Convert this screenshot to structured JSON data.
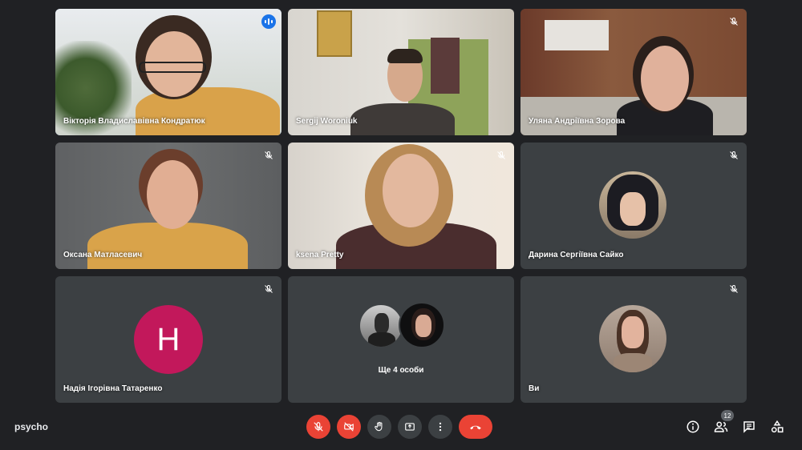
{
  "meeting": {
    "name": "psycho"
  },
  "participants": [
    {
      "name": "Вікторія Владиславівна Кондратюк",
      "speaking": true
    },
    {
      "name": "Sergij Woroniuk"
    },
    {
      "name": "Уляна Андріївна Зорова"
    },
    {
      "name": "Оксана Матласевич"
    },
    {
      "name": "ksena Pretty"
    },
    {
      "name": "Дарина Сергіївна Сайко"
    },
    {
      "name": "Надія Ігорівна Татаренко",
      "initial": "H"
    },
    {
      "name": "Ще 4 особи"
    },
    {
      "name": "Ви"
    }
  ],
  "controls": {
    "people_count": "12"
  },
  "colors": {
    "background": "#202124",
    "tile": "#3c4043",
    "danger": "#ea4335",
    "speaking": "#1a73e8",
    "avatar_h": "#c2185b"
  },
  "icons": [
    "mic-off-icon",
    "camera-off-icon",
    "raise-hand-icon",
    "present-icon",
    "more-icon",
    "hangup-icon",
    "info-icon",
    "people-icon",
    "chat-icon",
    "activities-icon"
  ]
}
